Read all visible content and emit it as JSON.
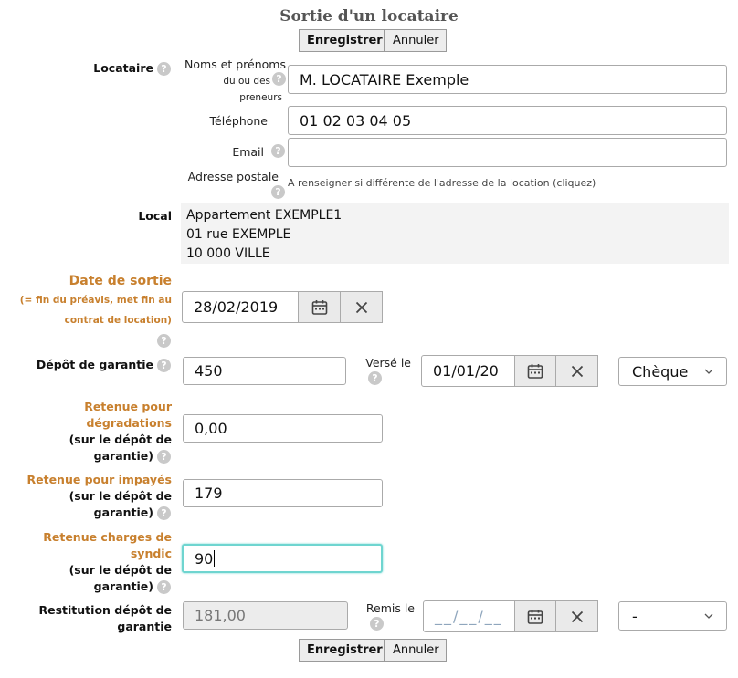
{
  "page": {
    "title": "Sortie d'un locataire",
    "save_label": "Enregistrer",
    "cancel_label": "Annuler"
  },
  "locataire": {
    "label": "Locataire",
    "names_label": [
      "Noms et prénoms",
      "du ou des",
      "preneurs"
    ],
    "names_value": "M. LOCATAIRE Exemple",
    "phone_label": "Téléphone",
    "phone_value": "01 02 03 04 05",
    "email_label": "Email",
    "email_value": "",
    "address_label": "Adresse postale",
    "address_note": "A renseigner si différente de l'adresse de la location (cliquez)"
  },
  "local": {
    "label": "Local",
    "lines": [
      "Appartement EXEMPLE1",
      "01 rue EXEMPLE",
      "10 000 VILLE"
    ]
  },
  "date_sortie": {
    "label": "Date de sortie",
    "sub": [
      "(= fin du préavis, met fin au",
      "contrat de location)"
    ],
    "value": "28/02/2019"
  },
  "depot": {
    "label": "Dépôt de garantie",
    "value": "450",
    "verse_label": "Versé le",
    "verse_value": "01/01/20",
    "payment_selected": "Chèque"
  },
  "retenue_degradations": {
    "label": [
      "Retenue pour",
      "dégradations"
    ],
    "sub": [
      "(sur le dépôt de",
      "garantie)"
    ],
    "value": "0,00"
  },
  "retenue_impayes": {
    "label": "Retenue pour impayés",
    "sub": [
      "(sur le dépôt de",
      "garantie)"
    ],
    "value": "179"
  },
  "retenue_charges": {
    "label": [
      "Retenue charges de",
      "syndic"
    ],
    "sub": [
      "(sur le dépôt de",
      "garantie)"
    ],
    "value": "90"
  },
  "restitution": {
    "label": [
      "Restitution dépôt de",
      "garantie"
    ],
    "value": "181,00",
    "remis_label": "Remis le",
    "remis_placeholder": "__/__/__",
    "select_selected": "-"
  }
}
